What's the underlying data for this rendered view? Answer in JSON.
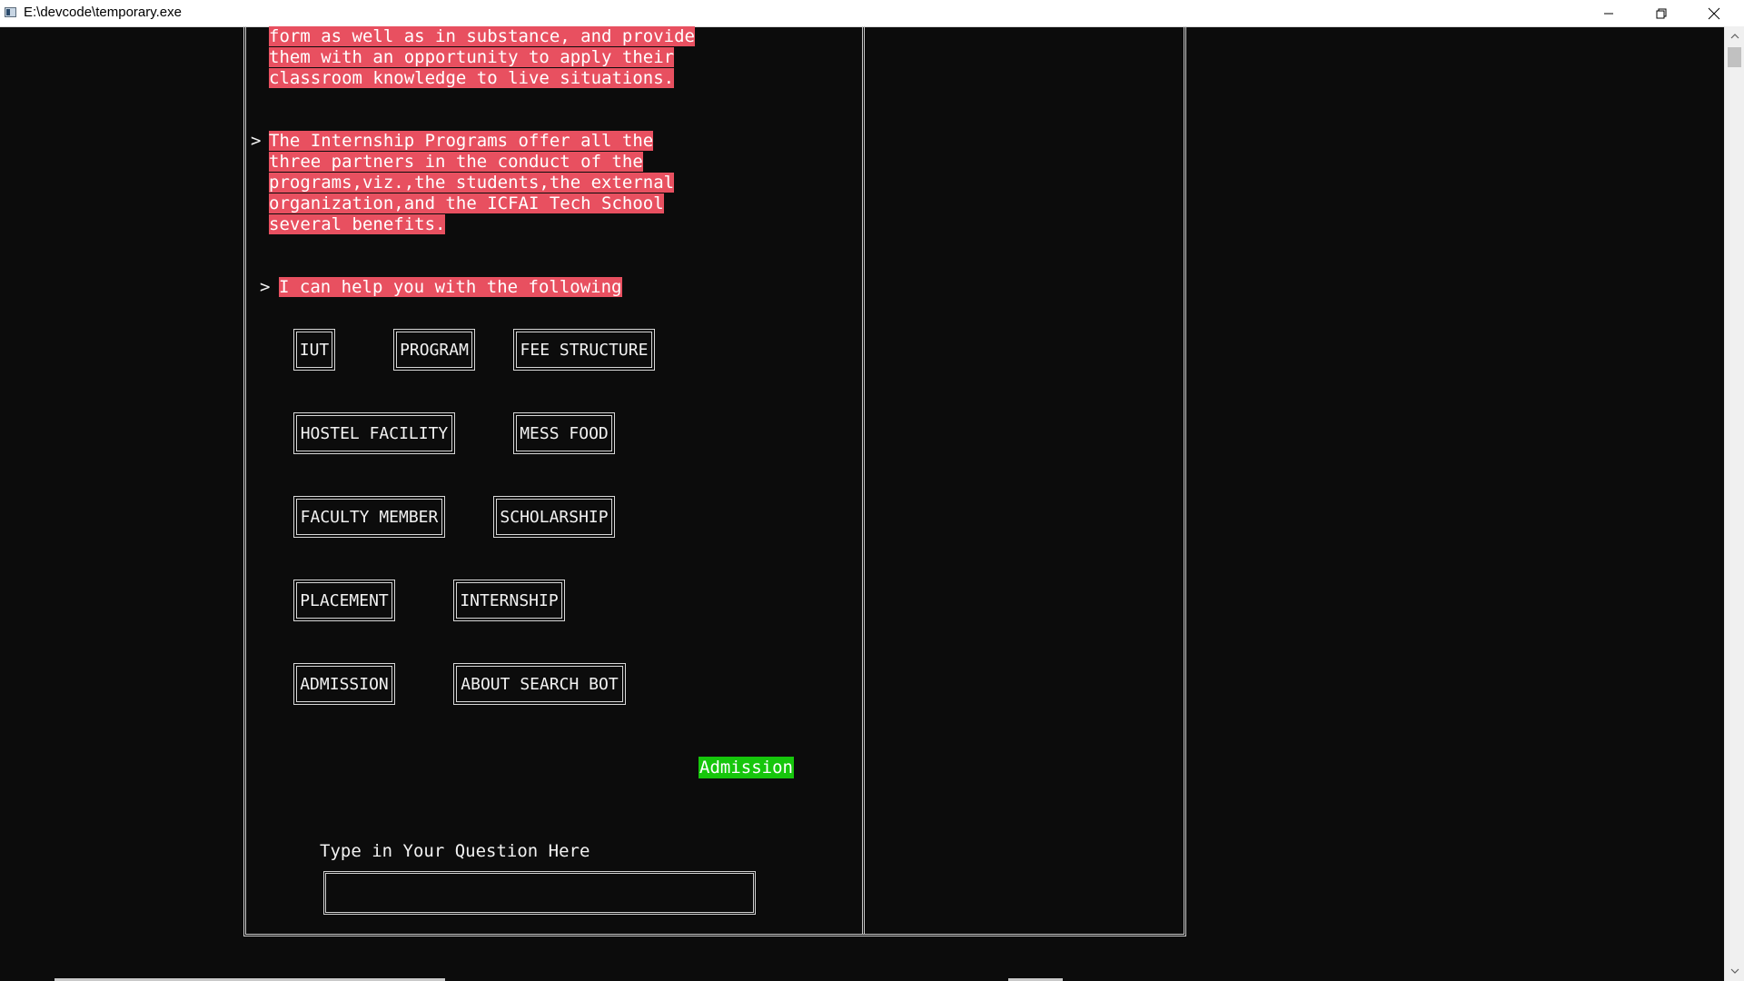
{
  "window": {
    "title": "E:\\devcode\\temporary.exe",
    "icons": {
      "app": "console-app-icon",
      "minimize": "minimize-icon",
      "maximize": "restore-icon",
      "close": "close-icon"
    }
  },
  "chat": {
    "paragraph1": [
      "form as well as in substance, and provide",
      "them with an opportunity to apply their",
      "classroom knowledge to live situations."
    ],
    "paragraph2_prompt": ">",
    "paragraph2": [
      "The Internship Programs offer all the",
      "three partners in the conduct of the",
      "programs,viz.,the students,the external",
      "organization,and the ICFAI Tech School",
      "several benefits."
    ],
    "help_prompt": ">",
    "help_text": "I can help you with the following",
    "highlight_color": "#e85060"
  },
  "menu": {
    "iut": "IUT",
    "program": "PROGRAM",
    "fee_structure": "FEE STRUCTURE",
    "hostel_facility": "HOSTEL FACILITY",
    "mess_food": "MESS FOOD",
    "faculty_member": "FACULTY MEMBER",
    "scholarship": "SCHOLARSHIP",
    "placement": "PLACEMENT",
    "internship": "INTERNSHIP",
    "admission": "ADMISSION",
    "about_search_bot": "ABOUT SEARCH BOT"
  },
  "user_message": {
    "text": "Admission",
    "color": "#16c60c"
  },
  "question": {
    "label": "Type in Your Question Here",
    "value": ""
  }
}
